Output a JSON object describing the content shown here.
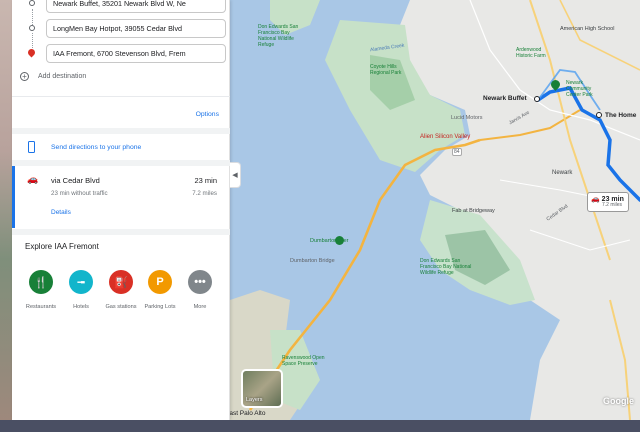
{
  "waypoints": [
    {
      "text": "Newark Buffet, 35201 Newark Blvd W, Ne"
    },
    {
      "text": "LongMen Bay Hotpot, 39055 Cedar Blvd"
    },
    {
      "text": "IAA Fremont, 6700 Stevenson Blvd, Frem"
    }
  ],
  "add_destination": "Add destination",
  "options_label": "Options",
  "send_directions": "Send directions to your phone",
  "route": {
    "via": "via Cedar Blvd",
    "time": "23 min",
    "note": "23 min without traffic",
    "distance": "7.2 miles",
    "details": "Details"
  },
  "explore": {
    "title": "Explore IAA Fremont",
    "items": [
      {
        "label": "Restaurants",
        "icon": "fork-knife-icon",
        "color": "#188038"
      },
      {
        "label": "Hotels",
        "icon": "bed-icon",
        "color": "#12b5cb"
      },
      {
        "label": "Gas stations",
        "icon": "fuel-icon",
        "color": "#d93025"
      },
      {
        "label": "Parking Lots",
        "icon": "parking-icon",
        "color": "#f29900"
      },
      {
        "label": "More",
        "icon": "more-icon",
        "color": "#80868b"
      }
    ]
  },
  "map": {
    "labels": {
      "newark_buffet": "Newark Buffet",
      "the_home": "The Home",
      "newark": "Newark",
      "american_high": "American High School",
      "alameda_creek": "Alameda Creek",
      "coyote_hills": "Coyote Hills Regional Park",
      "lucid_motors": "Lucid Motors",
      "ardenwood": "Ardenwood Historic Farm",
      "newark_community": "Newark Community Center Park",
      "jarvis": "Jarvis Ave",
      "alien_valley": "Alien Silicon Valley",
      "fab_bridgeway": "Fab at Bridgeway",
      "cedar_blvd": "Cedar Blvd",
      "dumbarton": "Dumbarton Pier",
      "dumbarton_bridge": "Dumbarton Bridge",
      "don_edwards": "Don Edwards San Francisco Bay National Wildlife Refuge",
      "ravenswood": "Ravenswood Open Space Preserve",
      "east_palo_alto": "East Palo Alto",
      "refuge_top": "Don Edwards San Francisco Bay National Wildlife Refuge",
      "highway_84": "84"
    },
    "layers_label": "Layers",
    "eta_time": "23 min",
    "eta_distance": "7.2 miles",
    "google": "Google"
  },
  "colors": {
    "route": "#1a73e8",
    "water": "#a9c7e6",
    "land": "#e8eaed",
    "park": "#bfe3c0"
  }
}
